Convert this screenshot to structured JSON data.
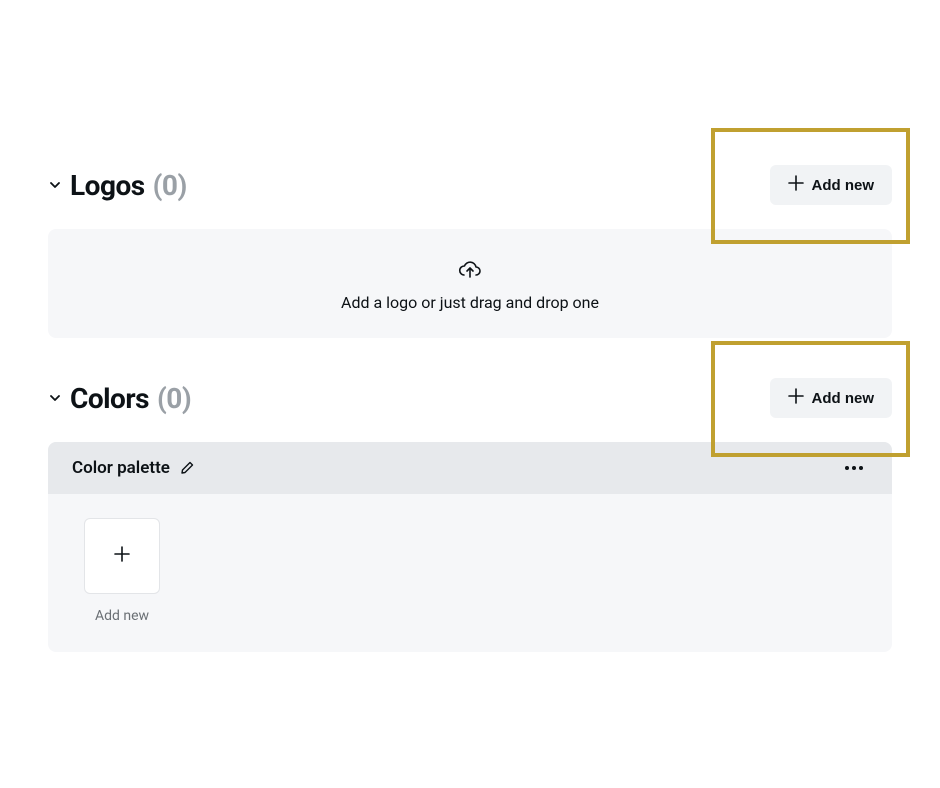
{
  "sections": {
    "logos": {
      "title": "Logos",
      "count": "(0)",
      "add_button": "Add new",
      "dropzone_text": "Add a logo or just drag and drop one"
    },
    "colors": {
      "title": "Colors",
      "count": "(0)",
      "add_button": "Add new",
      "palette": {
        "title": "Color palette",
        "add_swatch_label": "Add new"
      }
    }
  }
}
